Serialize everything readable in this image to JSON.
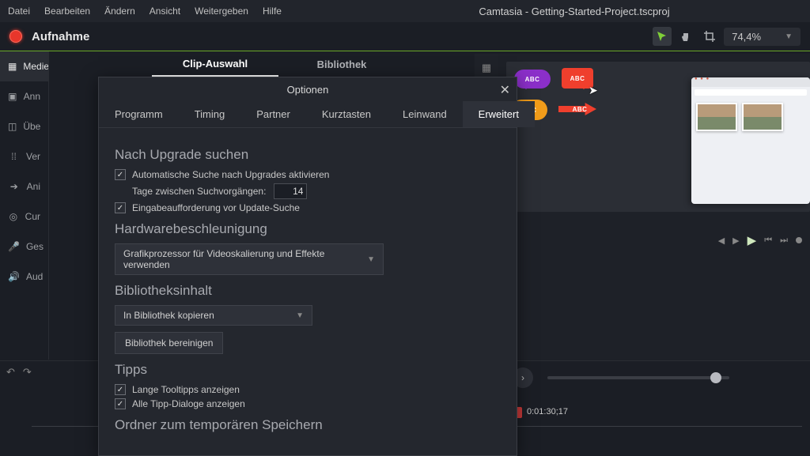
{
  "menu": {
    "items": [
      "Datei",
      "Bearbeiten",
      "Ändern",
      "Ansicht",
      "Weitergeben",
      "Hilfe"
    ],
    "title": "Camtasia - Getting-Started-Project.tscproj"
  },
  "record": {
    "label": "Aufnahme"
  },
  "zoom": {
    "value": "74,4%"
  },
  "sidebar": {
    "items": [
      {
        "label": "Medien"
      },
      {
        "label": "Ann"
      },
      {
        "label": "Übe"
      },
      {
        "label": "Ver"
      },
      {
        "label": "Ani"
      },
      {
        "label": "Cur"
      },
      {
        "label": "Ges"
      },
      {
        "label": "Aud"
      }
    ]
  },
  "panelTabs": {
    "a": "Clip-Auswahl",
    "b": "Bibliothek"
  },
  "dialog": {
    "title": "Optionen",
    "tabs": [
      "Programm",
      "Timing",
      "Partner",
      "Kurztasten",
      "Leinwand",
      "Erweitert"
    ],
    "upgrade": {
      "heading": "Nach Upgrade suchen",
      "auto": "Automatische Suche nach Upgrades aktivieren",
      "daysLabel": "Tage zwischen Suchvorgängen:",
      "daysValue": "14",
      "prompt": "Eingabeaufforderung vor Update-Suche"
    },
    "hw": {
      "heading": "Hardwarebeschleunigung",
      "combo": "Grafikprozessor für Videoskalierung und Effekte verwenden"
    },
    "lib": {
      "heading": "Bibliotheksinhalt",
      "combo": "In Bibliothek kopieren",
      "clean": "Bibliothek bereinigen"
    },
    "tips": {
      "heading": "Tipps",
      "long": "Lange Tooltipps anzeigen",
      "all": "Alle Tipp-Dialoge anzeigen"
    },
    "temp": {
      "heading": "Ordner zum temporären Speichern"
    }
  },
  "callout": {
    "abc": "ABC"
  },
  "timeline": {
    "time": "0:01:30;17"
  }
}
